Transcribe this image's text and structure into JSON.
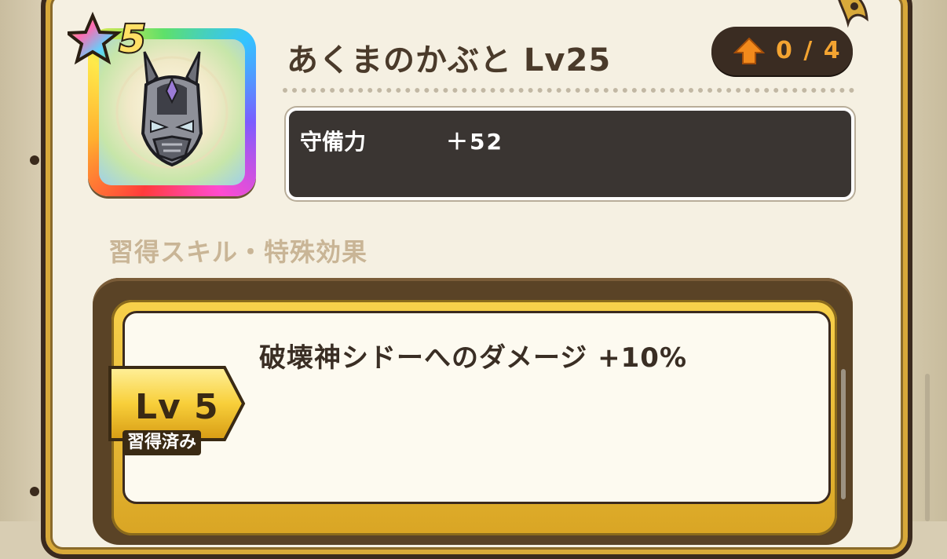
{
  "item": {
    "rarity": "5",
    "name": "あくまのかぶと Lv25",
    "upgrade_count": "0 / 4",
    "icon": "demon-helmet-icon",
    "frame_colors": [
      "#ff3b3b",
      "#ffb02e",
      "#ffe94a",
      "#5ee06a",
      "#33c3ff",
      "#7b5cff",
      "#ff4bd0"
    ]
  },
  "stats": [
    {
      "label": "守備力",
      "value": "＋52"
    }
  ],
  "skills_section": {
    "title": "習得スキル・特殊効果",
    "skills": [
      {
        "level": "Lv 5",
        "status": "習得済み",
        "description": "破壊神シドーへのダメージ +10%"
      }
    ]
  },
  "colors": {
    "title_text": "#4a3a2a",
    "upgrade_text": "#f4a431",
    "stat_box_bg": "#3a3532",
    "badge_gold": "#f8d14b"
  }
}
